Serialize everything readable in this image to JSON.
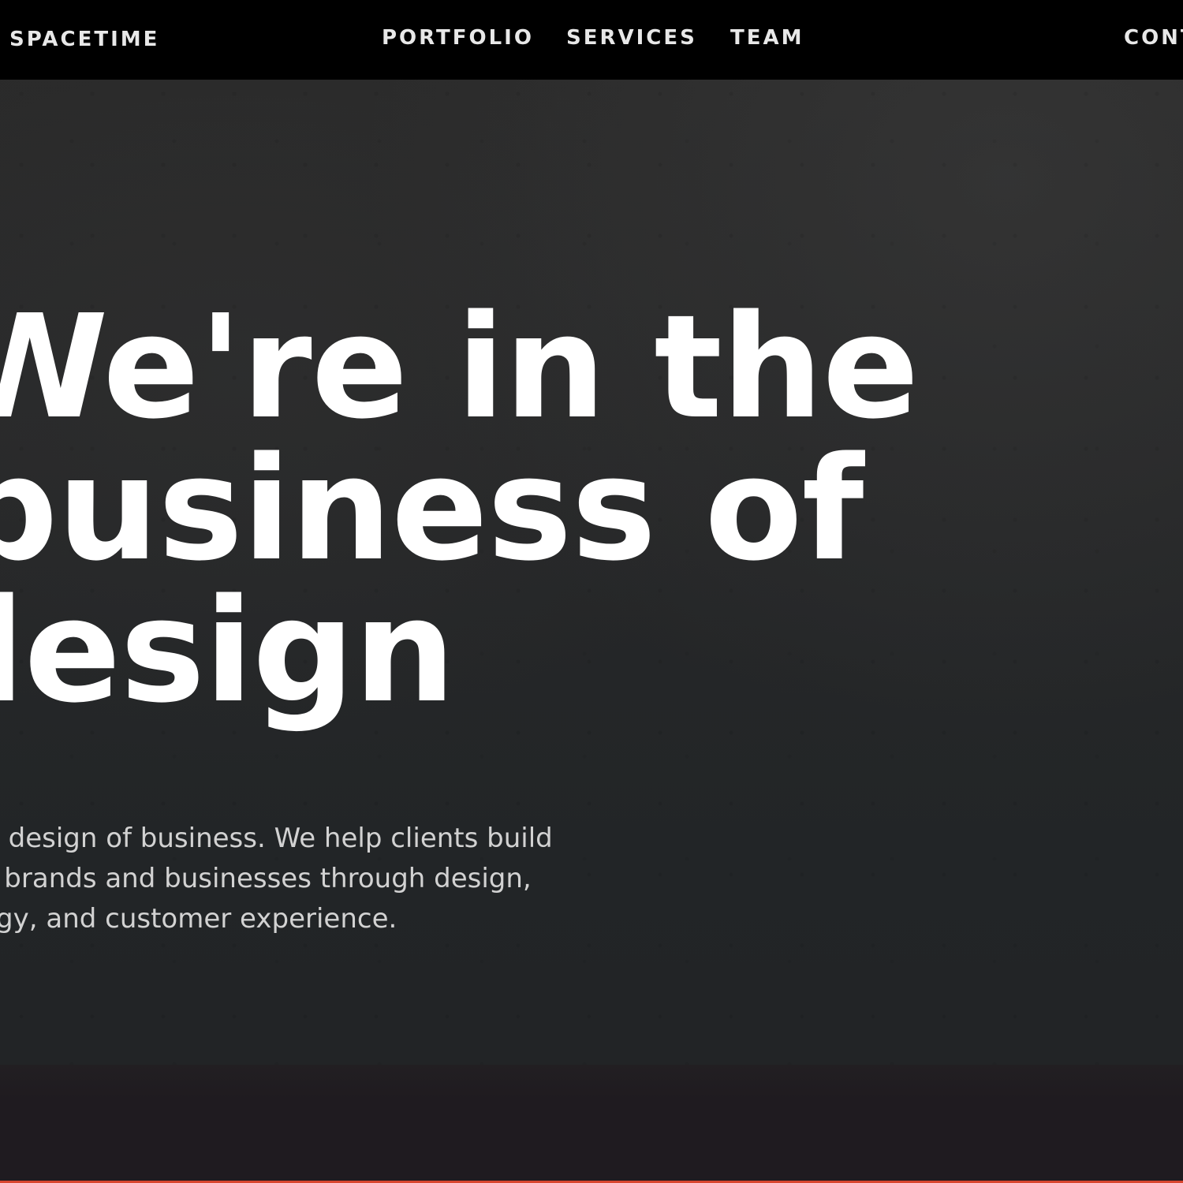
{
  "nav": {
    "brand": "SPACETIME",
    "links": [
      "PORTFOLIO",
      "SERVICES",
      "TEAM"
    ],
    "contact": "CONT"
  },
  "hero": {
    "headline_lines": [
      "We're in the",
      "business of",
      "design"
    ],
    "subtext_lines": [
      "the design of business. We help clients build",
      "ive brands and businesses through design,",
      "ology, and customer experience."
    ]
  },
  "colors": {
    "nav_background": "#000000",
    "hero_background": "#262728",
    "lower_band_background": "#1f1b20",
    "accent": "#d9462f"
  }
}
